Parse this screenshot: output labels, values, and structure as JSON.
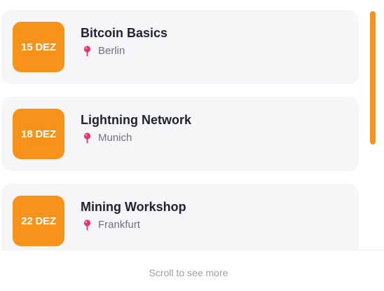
{
  "events": [
    {
      "date": "15 DEZ",
      "title": "Bitcoin Basics",
      "location": "Berlin"
    },
    {
      "date": "18 DEZ",
      "title": "Lightning Network",
      "location": "Munich"
    },
    {
      "date": "22 DEZ",
      "title": "Mining Workshop",
      "location": "Frankfurt"
    }
  ],
  "footer": {
    "hint": "Scroll to see more"
  },
  "colors": {
    "accent": "#f7931a",
    "pin": "#e5356b",
    "card_bg": "#f6f6f8"
  },
  "icons": {
    "location": "map-pin-icon"
  }
}
